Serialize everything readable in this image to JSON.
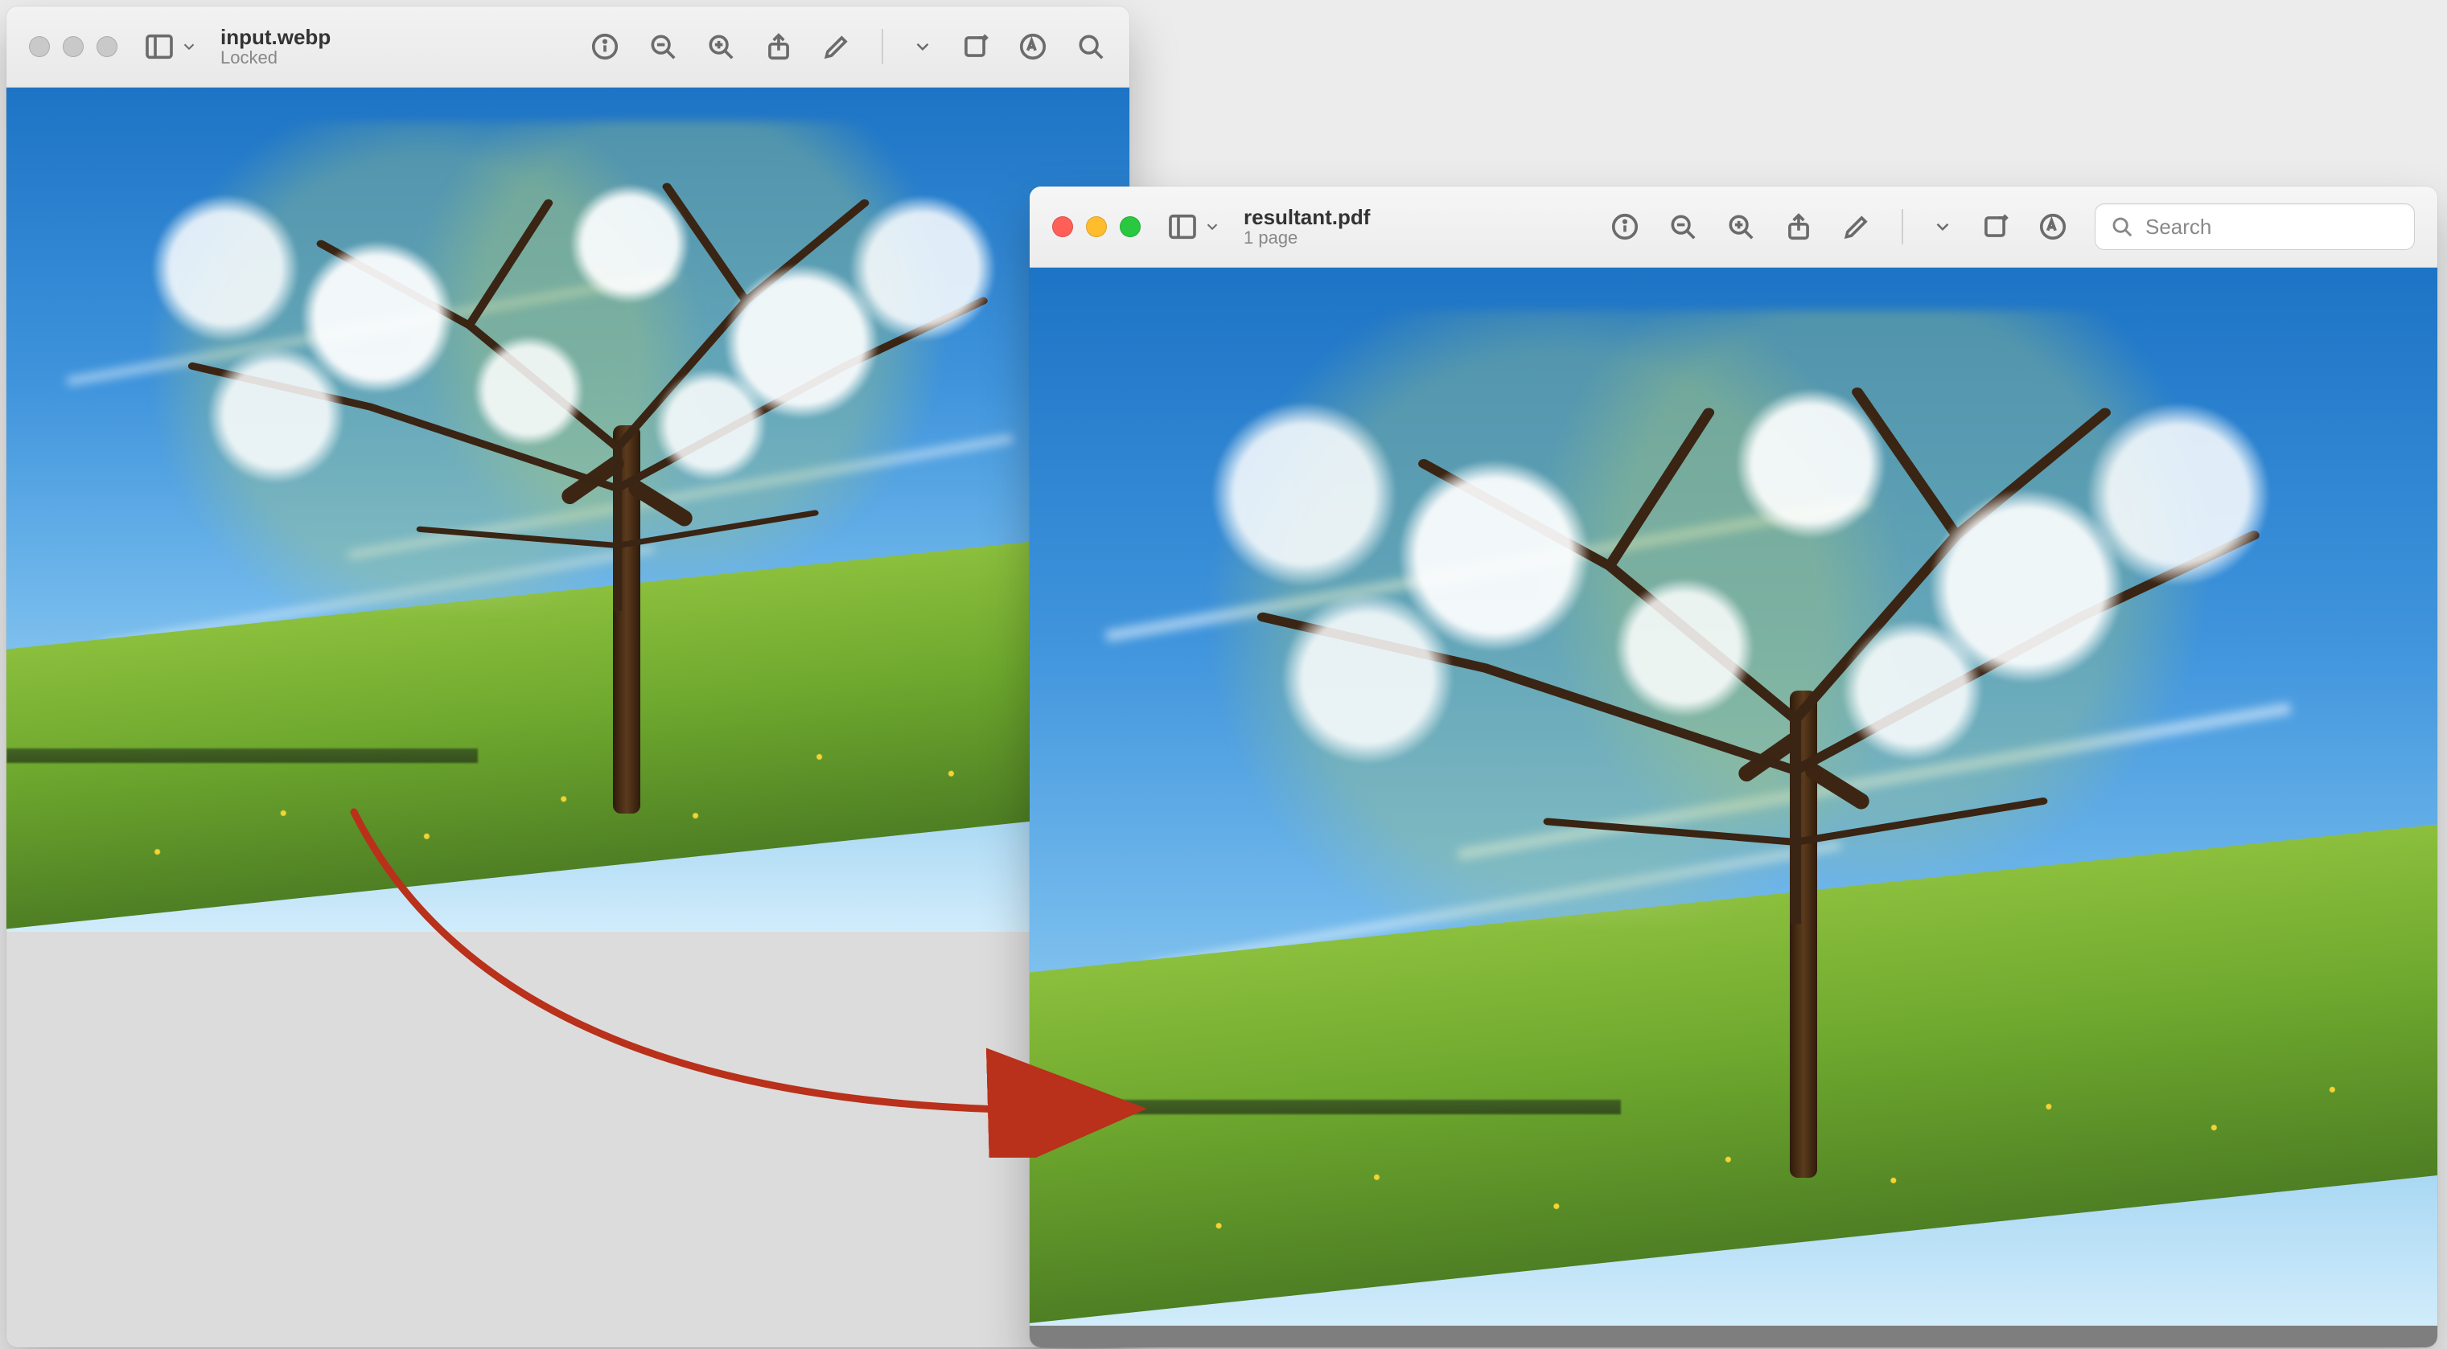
{
  "windows": [
    {
      "id": "left",
      "file_name": "input.webp",
      "subtitle": "Locked",
      "inactive": true,
      "search_placeholder": "",
      "has_search_box": false,
      "has_chevron_after_markup": true,
      "traffic": {
        "close": "#c9c9c9",
        "min": "#c9c9c9",
        "max": "#c9c9c9"
      },
      "background_focused": false
    },
    {
      "id": "right",
      "file_name": "resultant.pdf",
      "subtitle": "1 page",
      "inactive": false,
      "search_placeholder": "Search",
      "has_search_box": true,
      "has_chevron_after_markup": true,
      "traffic": {
        "close": "#ff5f57",
        "min": "#ffbd2e",
        "max": "#28c940"
      },
      "background_focused": true
    }
  ],
  "toolbar_icons": [
    {
      "name": "info-icon",
      "interactable": true
    },
    {
      "name": "zoom-out-icon",
      "interactable": true
    },
    {
      "name": "zoom-in-icon",
      "interactable": true
    },
    {
      "name": "share-icon",
      "interactable": true
    },
    {
      "name": "markup-icon",
      "interactable": true
    },
    {
      "name": "chevron-down-icon",
      "interactable": true
    },
    {
      "name": "rotate-icon",
      "interactable": true
    },
    {
      "name": "highlight-icon",
      "interactable": true
    }
  ],
  "arrow": {
    "color": "#b9301b"
  },
  "image_content": {
    "description": "Blossoming tree with white flowers on a green hillside under a blue sky",
    "sky_color_top": "#1d74c5",
    "sky_color_bottom": "#a7d7f3",
    "ground_color": "#6ea82e",
    "blossom_color": "#f7f7f2"
  }
}
